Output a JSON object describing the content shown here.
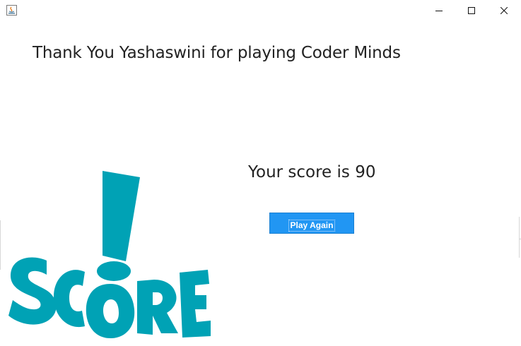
{
  "window": {
    "controls": {
      "minimize_icon": "minimize-icon",
      "maximize_icon": "maximize-icon",
      "close_icon": "close-icon"
    },
    "app_icon": "java-app-icon"
  },
  "content": {
    "thanks_message": "Thank You Yashaswini for playing Coder Minds",
    "score_message": "Your score is 90",
    "play_again_label": "Play Again",
    "logo_text": "SCORE"
  },
  "colors": {
    "logo": "#00a2b5",
    "button": "#2196f3",
    "text": "#222222"
  }
}
